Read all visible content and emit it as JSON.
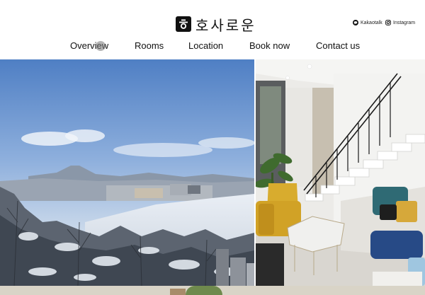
{
  "brand": {
    "name": "호사로운",
    "logo_icon": "hieut-logo-icon"
  },
  "social": {
    "kakao_label": "Kakaotalk",
    "kakao_icon": "kakaotalk-icon",
    "instagram_label": "Instagram",
    "instagram_icon": "instagram-icon"
  },
  "nav": {
    "items": [
      {
        "label": "Overview"
      },
      {
        "label": "Rooms"
      },
      {
        "label": "Location"
      },
      {
        "label": "Book now"
      },
      {
        "label": "Contact us"
      }
    ]
  },
  "gallery": {
    "images": [
      {
        "subject": "snowy-mountain-view-photo"
      },
      {
        "subject": "living-room-interior-photo"
      }
    ]
  },
  "colors": {
    "background": "#ffffff",
    "text": "#111111"
  }
}
